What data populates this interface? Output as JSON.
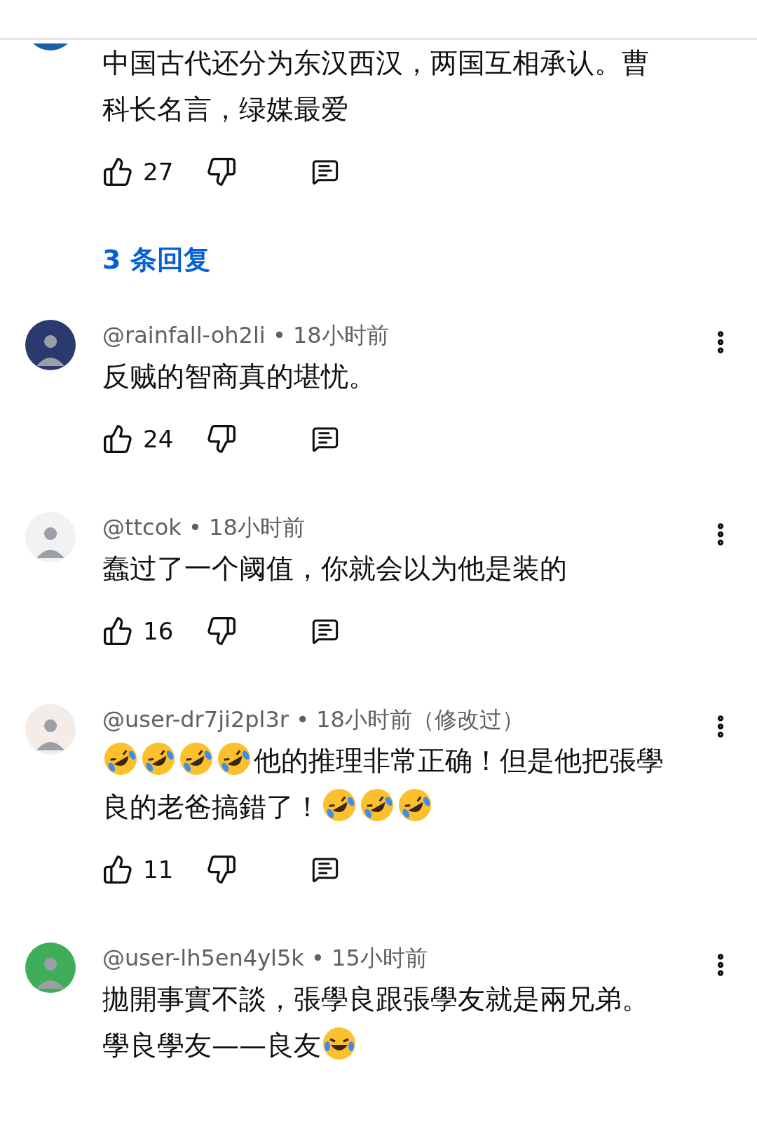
{
  "comments": [
    {
      "avatar": {
        "color": "#1a5fa8"
      },
      "body": [
        {
          "kind": "text",
          "text": "中国古代还分为东汉西汉，两国互相承认。曹科长名言，绿媒最爱"
        }
      ],
      "likes": "27",
      "replies": "3 条回复"
    },
    {
      "meta": "@rainfall-oh2li • 18小时前",
      "avatar": {
        "color": "#2b3a6e"
      },
      "body": [
        {
          "kind": "text",
          "text": "反贼的智商真的堪忧。"
        }
      ],
      "likes": "24"
    },
    {
      "meta": "@ttcok • 18小时前",
      "avatar": {
        "color": "#f2f2f2"
      },
      "body": [
        {
          "kind": "text",
          "text": "蠢过了一个阈值，你就会以为他是装的"
        }
      ],
      "likes": "16"
    },
    {
      "meta": "@user-dr7ji2pl3r • 18小时前（修改过）",
      "avatar": {
        "color": "#f4ece6"
      },
      "body": [
        {
          "kind": "emoji"
        },
        {
          "kind": "emoji"
        },
        {
          "kind": "emoji"
        },
        {
          "kind": "emoji"
        },
        {
          "kind": "text",
          "text": "他的推理非常正确！但是他把張學良的老爸搞錯了！"
        },
        {
          "kind": "emoji"
        },
        {
          "kind": "emoji"
        },
        {
          "kind": "emoji"
        }
      ],
      "likes": "11"
    },
    {
      "meta": "@user-lh5en4yl5k • 15小时前",
      "avatar": {
        "color": "#3fae5a"
      },
      "body": [
        {
          "kind": "text",
          "text": "拋開事實不談，張學良跟張學友就是兩兄弟。學良學友——良友"
        },
        {
          "kind": "tears"
        }
      ]
    }
  ]
}
